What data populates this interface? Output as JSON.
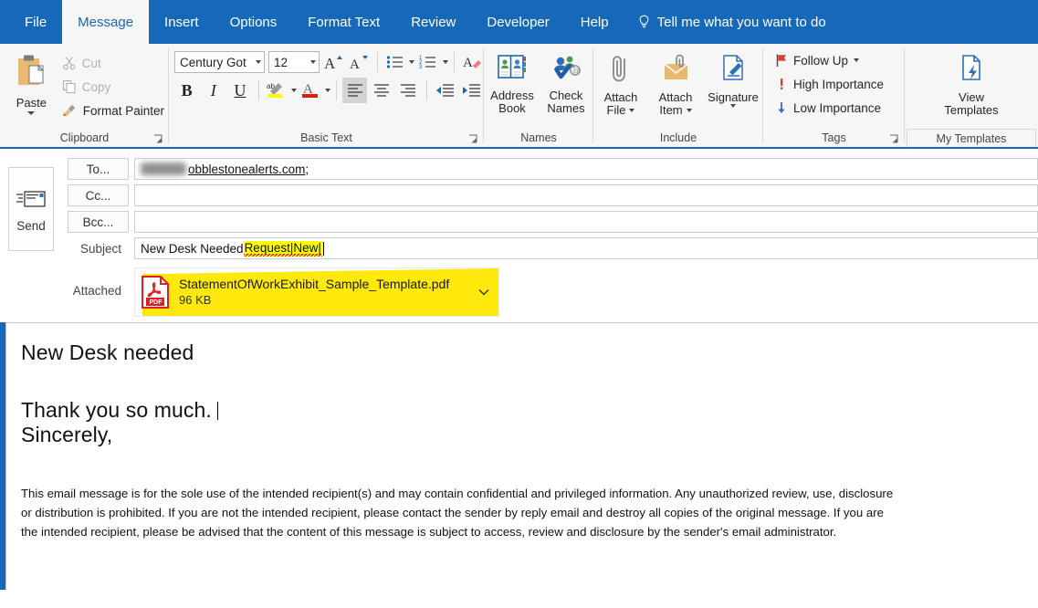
{
  "tabs": [
    {
      "label": "File",
      "active": false
    },
    {
      "label": "Message",
      "active": true
    },
    {
      "label": "Insert",
      "active": false
    },
    {
      "label": "Options",
      "active": false
    },
    {
      "label": "Format Text",
      "active": false
    },
    {
      "label": "Review",
      "active": false
    },
    {
      "label": "Developer",
      "active": false
    },
    {
      "label": "Help",
      "active": false
    }
  ],
  "tell_me": "Tell me what you want to do",
  "ribbon": {
    "clipboard": {
      "group_label": "Clipboard",
      "paste": "Paste",
      "cut": "Cut",
      "copy": "Copy",
      "format_painter": "Format Painter"
    },
    "basic_text": {
      "group_label": "Basic Text",
      "font_name": "Century Got",
      "font_size": "12",
      "grow_font": "A",
      "shrink_font": "A",
      "bold": "B",
      "italic": "I",
      "underline": "U",
      "highlight_color": "#ffff00",
      "font_color": "#e01b00"
    },
    "names": {
      "group_label": "Names",
      "address_book": "Address\nBook",
      "address_book_line1": "Address",
      "address_book_line2": "Book",
      "check_names_line1": "Check",
      "check_names_line2": "Names"
    },
    "include": {
      "group_label": "Include",
      "attach_file_line1": "Attach",
      "attach_file_line2": "File",
      "attach_item_line1": "Attach",
      "attach_item_line2": "Item",
      "signature": "Signature"
    },
    "tags": {
      "group_label": "Tags",
      "follow_up": "Follow Up",
      "high_importance": "High Importance",
      "low_importance": "Low Importance"
    },
    "templates": {
      "group_label": "My Templates",
      "view_line1": "View",
      "view_line2": "Templates"
    }
  },
  "compose": {
    "send": "Send",
    "to_button": "To...",
    "cc_button": "Cc...",
    "bcc_button": "Bcc...",
    "to_value_visible": "obblestonealerts.com",
    "to_separator": ";",
    "cc_value": "",
    "bcc_value": "",
    "subject_label": "Subject",
    "subject_plain": "New Desk Needed ",
    "subject_highlighted": "Request|New|",
    "attached_label": "Attached",
    "attachment": {
      "icon": "pdf-file-icon",
      "name": "StatementOfWorkExhibit_Sample_Template.pdf",
      "size": "96 KB"
    }
  },
  "body": {
    "heading": "New Desk needed",
    "line1": "Thank you so much.",
    "line2": "Sincerely,",
    "disclaimer": "This email message is for the sole use of the intended recipient(s) and may contain confidential and privileged information. Any unauthorized review, use, disclosure or distribution is prohibited. If you are not the intended recipient, please contact the sender by reply email and destroy all copies of the original message. If you are the intended recipient, please be advised that the content of this message is subject to access, review and disclosure by the sender's email administrator."
  }
}
